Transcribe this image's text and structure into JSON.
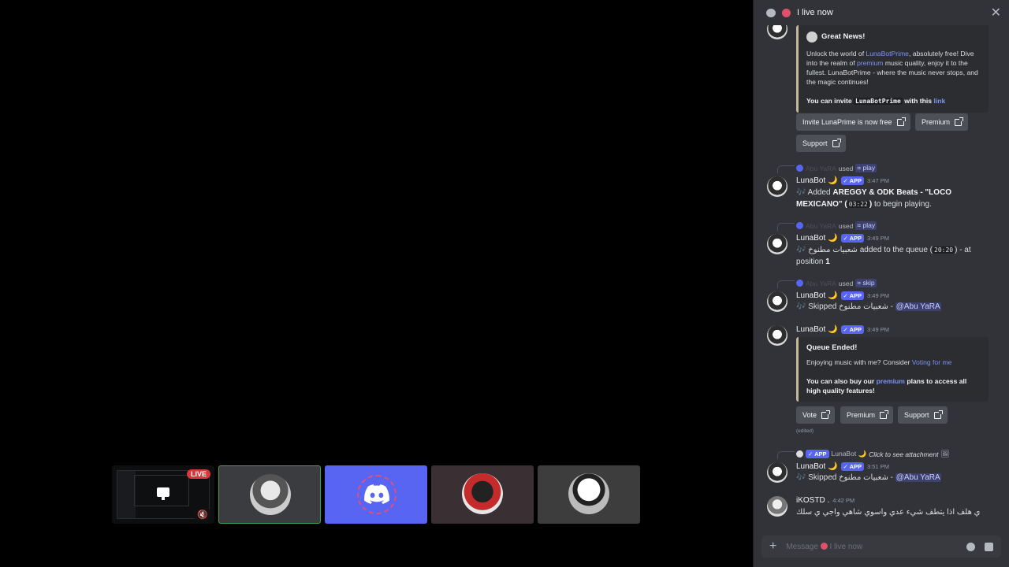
{
  "panel": {
    "title": "I live now",
    "composer_placeholder": "Message",
    "composer_suffix": "I live now"
  },
  "tiles": [
    {
      "kind": "screen",
      "live_label": "LIVE"
    },
    {
      "kind": "user"
    },
    {
      "kind": "discord"
    },
    {
      "kind": "user"
    },
    {
      "kind": "user"
    }
  ],
  "embed1": {
    "title": "Great News!",
    "text1_a": "Unlock the world of ",
    "text1_link": "LunaBotPrime",
    "text1_b": ", absolutely free! Dive into the realm of ",
    "text1_link2": "premium",
    "text1_c": " music quality, enjoy it to the fullest. LunaBotPrime - where the music never stops, and the magic continues!",
    "invite_a": "You can invite ",
    "invite_code": "LunaBotPrime",
    "invite_b": " with this ",
    "invite_link": "link"
  },
  "buttons1": [
    "Invite LunaPrime is now free",
    "Premium",
    "Support"
  ],
  "msg1": {
    "reply_user": "Abu YaRA",
    "reply_used": "used",
    "reply_cmd": "⌗ play",
    "author": "LunaBot 🌙",
    "app": "✓ APP",
    "time": "3:47 PM",
    "body_a": "🎶 Added ",
    "body_bold": "AREGGY & ODK Beats - \"LOCO MEXICANO\" (",
    "body_code": "03:22",
    "body_bold2": ")",
    "body_b": " to begin playing."
  },
  "msg2": {
    "reply_user": "Abu YaRA",
    "reply_used": "used",
    "reply_cmd": "⌗ play",
    "author": "LunaBot 🌙",
    "app": "✓ APP",
    "time": "3:49 PM",
    "body_a": "🎶 شعبيات مطنوخ",
    "body_b": " added to the queue (",
    "body_code": "20:20",
    "body_c": ") - at position ",
    "body_pos": "1"
  },
  "msg3": {
    "reply_user": "Abu YaRA",
    "reply_used": "used",
    "reply_cmd": "⌗ skip",
    "author": "LunaBot 🌙",
    "app": "✓ APP",
    "time": "3:49 PM",
    "body_a": "🎶 Skipped شعبيات مطنوخ - ",
    "mention": "@Abu YaRA"
  },
  "msg4": {
    "author": "LunaBot 🌙",
    "app": "✓ APP",
    "time": "3:49 PM",
    "embed_title": "Queue Ended!",
    "embed_a": "Enjoying music with me? Consider ",
    "embed_link": "Voting for me",
    "embed_b": "You can also buy our ",
    "embed_link2": "premium",
    "embed_c": " plans to access all high quality features!",
    "buttons": [
      "Vote",
      "Premium",
      "Support"
    ],
    "edited": "(edited)"
  },
  "msg5": {
    "reply_app": "✓ APP",
    "reply_user": "LunaBot 🌙",
    "reply_text": "Click to see attachment",
    "author": "LunaBot 🌙",
    "app": "✓ APP",
    "time": "3:51 PM",
    "body_a": "🎶 Skipped شعبيات مطنوخ - ",
    "mention": "@Abu YaRA"
  },
  "msg6": {
    "author": "iKOSTD .",
    "time": "4:42 PM",
    "body": "ي هلف اذا يتطف شيء عدي واسوي شاهي واجي ي سلك"
  }
}
